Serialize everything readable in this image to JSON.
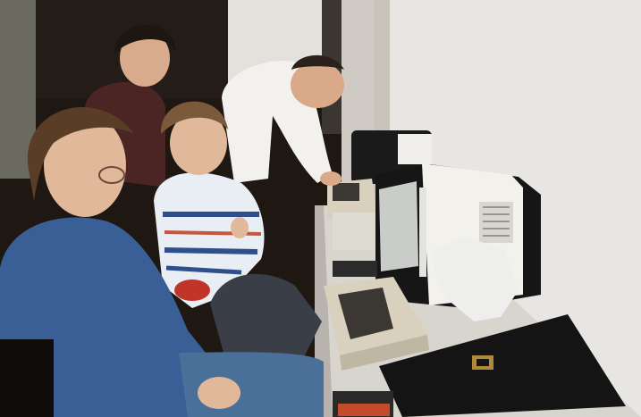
{
  "photo": {
    "subject": "",
    "colors": {
      "wall": "#e8e6e2",
      "wall_shadow": "#b9b4ad",
      "left_wall": "#6b6a5e",
      "desk": "#d8d5cf",
      "sweater_blue": "#3a5f96",
      "nordic_sweater": "#e9eef5",
      "nordic_pattern": "#2f4f8c",
      "hair_brown": "#5a3d26",
      "hair_dark": "#1d1611",
      "skin": "#e2b89a",
      "monitor_white": "#f2f1ec",
      "monitor_black": "#1a1a1a",
      "screen": "#c9ccc8",
      "keyboard_body": "#d9d1bd",
      "keyboard_keys": "#3b3834",
      "bag": "#141414",
      "buckle": "#b08a3a",
      "jeans": "#4a6f98"
    }
  }
}
